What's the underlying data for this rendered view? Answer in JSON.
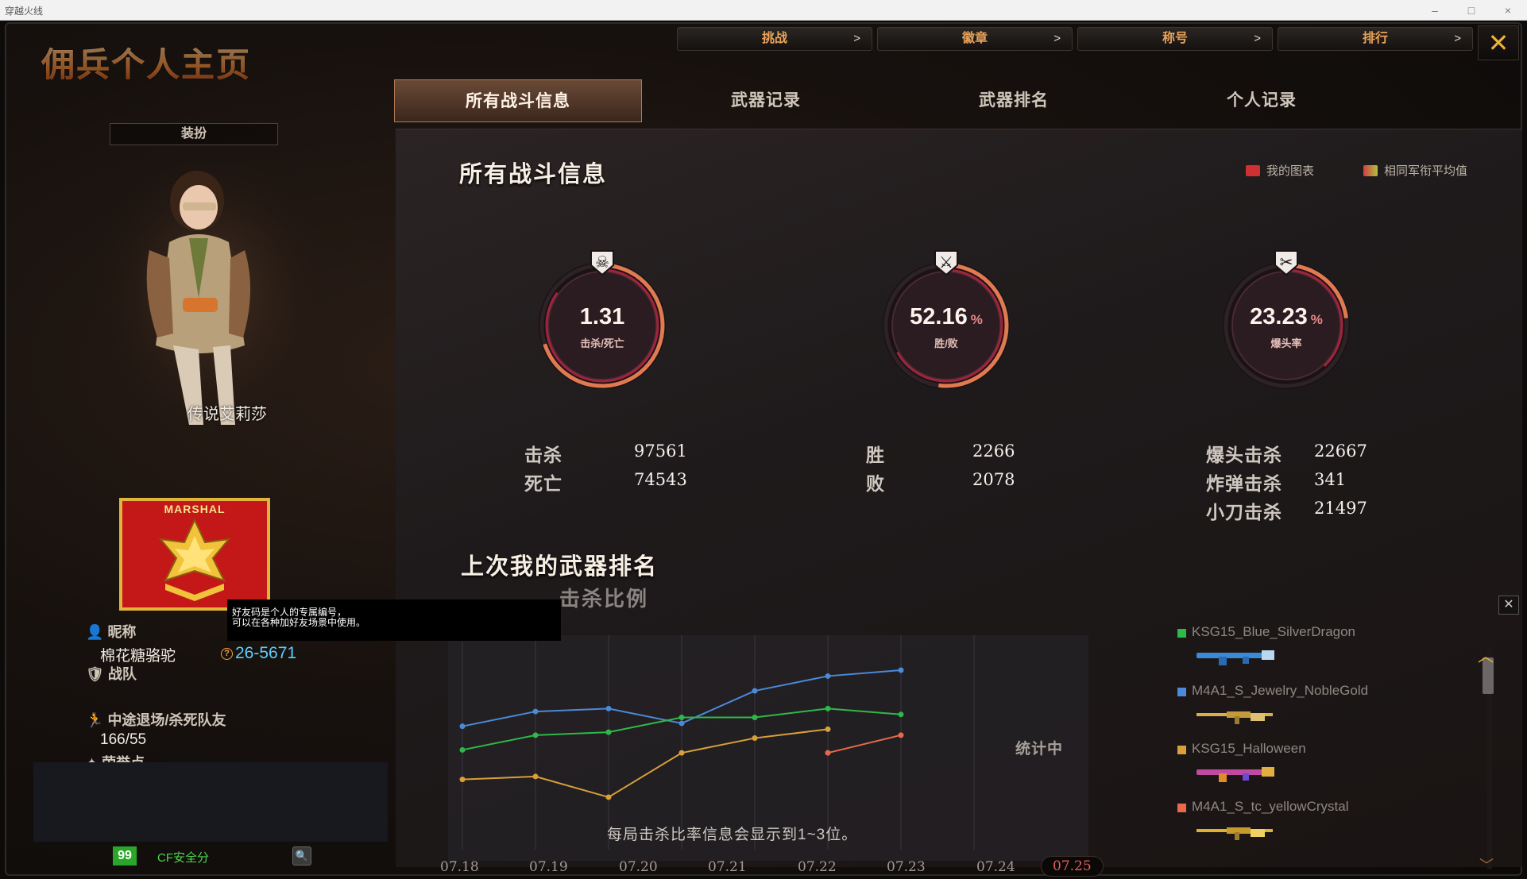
{
  "window": {
    "title": "穿越火线",
    "minimize": "–",
    "maximize": "□",
    "close": "×"
  },
  "page_title": "佣兵个人主页",
  "top_nav": [
    {
      "label": "挑战",
      "arrow": ">"
    },
    {
      "label": "徽章",
      "arrow": ">"
    },
    {
      "label": "称号",
      "arrow": ">"
    },
    {
      "label": "排行",
      "arrow": ">"
    }
  ],
  "close_label": "✕",
  "tabs": [
    "所有战斗信息",
    "武器记录",
    "武器排名",
    "个人记录"
  ],
  "active_tab": 0,
  "left": {
    "dress_button": "装扮",
    "character_name": "传说艾莉莎",
    "rank_text": "MARSHAL",
    "tooltip_line1": "好友码是个人的专属编号，",
    "tooltip_line2": "可以在各种加好友场景中使用。",
    "nickname_label": "昵称",
    "nickname": "棉花糖骆驼",
    "friend_code": "26-5671",
    "team_label": "战队",
    "quit_label": "中途退场/杀死队友",
    "quit_value": "166/55",
    "honor_label": "荣誉点",
    "security_score": "99",
    "security_label": "CF安全分"
  },
  "main": {
    "section_title": "所有战斗信息",
    "legend_mine": "我的图表",
    "legend_avg": "相同军衔平均值",
    "legend_mine_color": "#d03030",
    "legend_avg_color": "#b0c040",
    "gauges": [
      {
        "value": "1.31",
        "pct": "",
        "label": "击杀/死亡",
        "icon": "skull-icon",
        "fill": 0.7
      },
      {
        "value": "52.16",
        "pct": "%",
        "label": "胜/败",
        "icon": "crossed-swords-icon",
        "fill": 0.52
      },
      {
        "value": "23.23",
        "pct": "%",
        "label": "爆头率",
        "icon": "crossed-guns-icon",
        "fill": 0.23
      }
    ],
    "stats_kd": [
      {
        "label": "击杀",
        "value": "97561"
      },
      {
        "label": "死亡",
        "value": "74543"
      }
    ],
    "stats_wl": [
      {
        "label": "胜",
        "value": "2266"
      },
      {
        "label": "败",
        "value": "2078"
      }
    ],
    "stats_hs": [
      {
        "label": "爆头击杀",
        "value": "22667"
      },
      {
        "label": "炸弹击杀",
        "value": "341"
      },
      {
        "label": "小刀击杀",
        "value": "21497"
      }
    ],
    "weapon_rank_title": "上次我的武器排名",
    "kill_ratio_title": "击杀比例",
    "counting_label": "统计中",
    "chart_note": "每局击杀比率信息会显示到1~3位。",
    "panel_close": "✕",
    "weapons": [
      {
        "name": "KSG15_Blue_SilverDragon",
        "color": "#2fb84a"
      },
      {
        "name": "M4A1_S_Jewelry_NobleGold",
        "color": "#4a8ad8"
      },
      {
        "name": "KSG15_Halloween",
        "color": "#d8a03a"
      },
      {
        "name": "M4A1_S_tc_yellowCrystal",
        "color": "#e86a4a"
      }
    ]
  },
  "chart_data": {
    "type": "line",
    "categories": [
      "07.18",
      "07.19",
      "07.20",
      "07.21",
      "07.22",
      "07.23",
      "07.24",
      "07.25"
    ],
    "active_category": "07.25",
    "series": [
      {
        "color": "#4a8ad8",
        "values": [
          0.62,
          0.72,
          0.74,
          0.64,
          0.86,
          0.96,
          1.0,
          null
        ]
      },
      {
        "color": "#2fb84a",
        "values": [
          0.46,
          0.56,
          0.58,
          0.68,
          0.68,
          0.74,
          0.7,
          null
        ]
      },
      {
        "color": "#d8a03a",
        "values": [
          0.26,
          0.28,
          0.14,
          0.44,
          0.54,
          0.6,
          null,
          null
        ]
      },
      {
        "color": "#e86a4a",
        "values": [
          null,
          null,
          null,
          null,
          null,
          0.44,
          0.56,
          null
        ]
      }
    ]
  }
}
